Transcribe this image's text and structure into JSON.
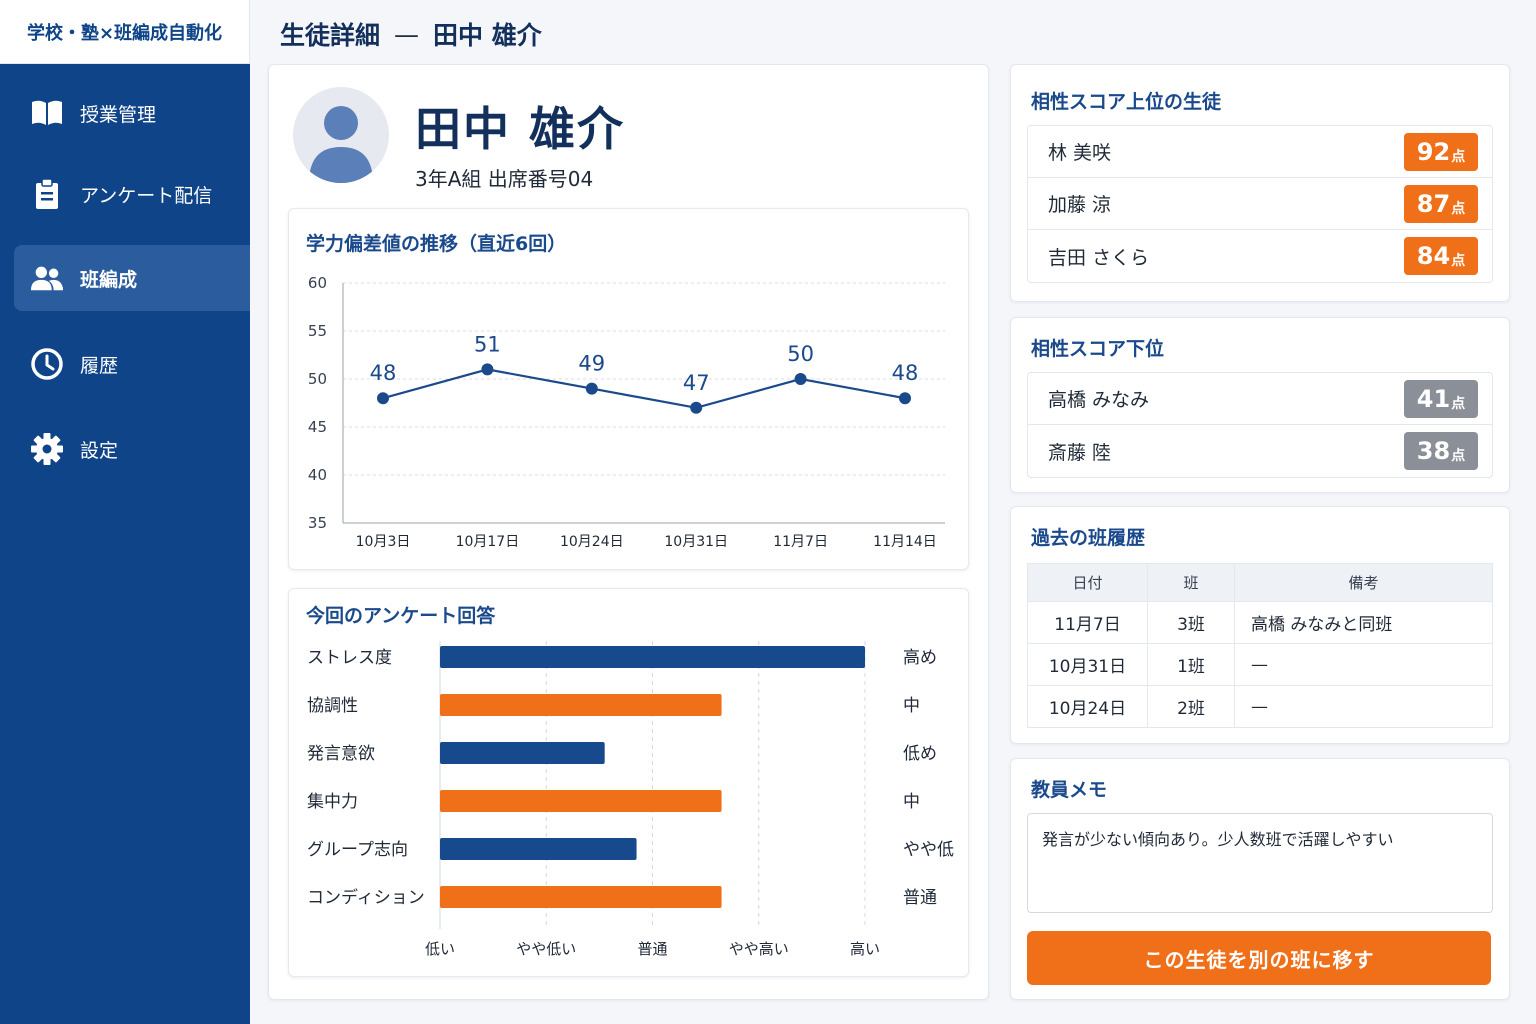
{
  "app": {
    "title": "学校・塾×班編成自動化"
  },
  "sidebar": {
    "items": [
      {
        "label": "授業管理",
        "icon": "book-icon",
        "active": false
      },
      {
        "label": "アンケート配信",
        "icon": "clipboard-icon",
        "active": false
      },
      {
        "label": "班編成",
        "icon": "users-icon",
        "active": true
      },
      {
        "label": "履歴",
        "icon": "clock-icon",
        "active": false
      },
      {
        "label": "設定",
        "icon": "gear-icon",
        "active": false
      }
    ]
  },
  "header": {
    "section": "生徒詳細",
    "separator": "—",
    "student": "田中 雄介"
  },
  "student": {
    "name": "田中 雄介",
    "class_info": "3年A組 出席番号04"
  },
  "trend": {
    "title": "学力偏差値の推移（直近6回）",
    "chart_data": {
      "type": "line",
      "title": "学力偏差値の推移（直近6回）",
      "xlabel": "",
      "ylabel": "",
      "categories": [
        "10月3日",
        "10月17日",
        "10月24日",
        "10月31日",
        "11月7日",
        "11月14日"
      ],
      "series": [
        {
          "values": [
            48,
            51,
            49,
            47,
            50,
            48
          ]
        }
      ],
      "ylim": [
        35,
        60
      ],
      "yticks": [
        60,
        55,
        50,
        45,
        40,
        35
      ],
      "grid": true,
      "color": "#1a4a8c"
    }
  },
  "survey": {
    "title": "今回のアンケート回答",
    "chart_data": {
      "type": "bar",
      "orientation": "horizontal",
      "title": "今回のアンケート回答",
      "categories": [
        "ストレス度",
        "協調性",
        "発言意欲",
        "集中力",
        "グループ志向",
        "コンディション"
      ],
      "values": [
        4,
        2.65,
        1.55,
        2.65,
        1.85,
        2.65
      ],
      "value_labels": [
        "高め",
        "中",
        "低め",
        "中",
        "やや低",
        "普通"
      ],
      "colors": [
        "#174a8c",
        "#f07019",
        "#174a8c",
        "#f07019",
        "#174a8c",
        "#f07019"
      ],
      "xlim": [
        0,
        4
      ],
      "xticks": [
        "低い",
        "やや低い",
        "普通",
        "やや高い",
        "高い"
      ],
      "grid": true
    }
  },
  "top_matches": {
    "title": "相性スコア上位の生徒",
    "items": [
      {
        "name": "林 美咲",
        "score": "92",
        "unit": "点"
      },
      {
        "name": "加藤 涼",
        "score": "87",
        "unit": "点"
      },
      {
        "name": "吉田 さくら",
        "score": "84",
        "unit": "点"
      }
    ],
    "color": "#f07019"
  },
  "bottom_matches": {
    "title": "相性スコア下位",
    "items": [
      {
        "name": "高橋 みなみ",
        "score": "41",
        "unit": "点"
      },
      {
        "name": "斎藤 陸",
        "score": "38",
        "unit": "点"
      }
    ],
    "color": "#8a8f98"
  },
  "history": {
    "title": "過去の班履歴",
    "columns": [
      "日付",
      "班",
      "備考"
    ],
    "rows": [
      [
        "11月7日",
        "3班",
        "高橋 みなみと同班"
      ],
      [
        "10月31日",
        "1班",
        "—"
      ],
      [
        "10月24日",
        "2班",
        "—"
      ]
    ]
  },
  "memo": {
    "title": "教員メモ",
    "value": "発言が少ない傾向あり。少人数班で活躍しやすい"
  },
  "action": {
    "move_label": "この生徒を別の班に移す"
  },
  "colors": {
    "primary": "#0f4488",
    "accent": "#f07019",
    "muted": "#8a8f98"
  }
}
